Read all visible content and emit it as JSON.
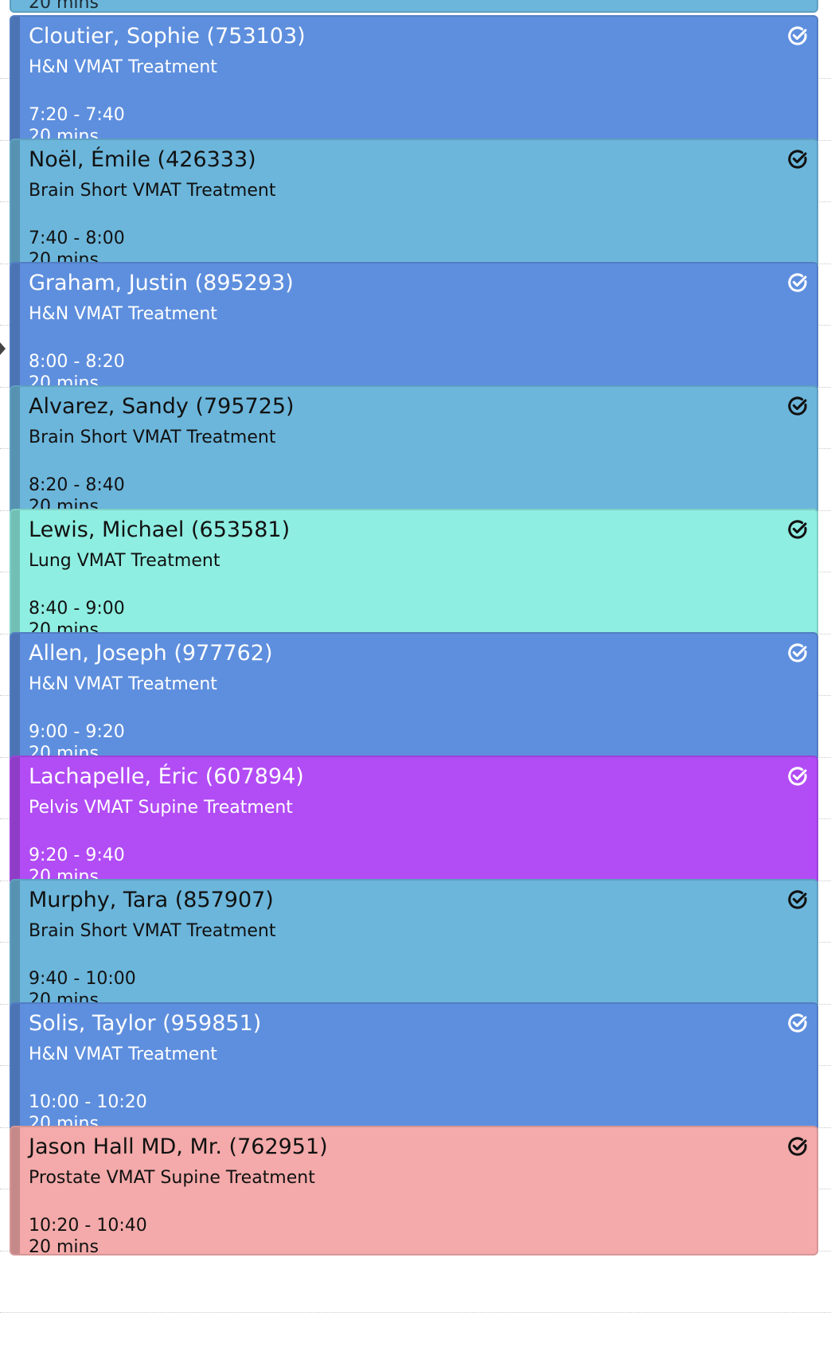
{
  "calendar": {
    "top_partial": {
      "duration": "20 mins",
      "color": "#6cb6db",
      "text_color": "#1d2a33"
    },
    "appointments": [
      {
        "patient": "Cloutier, Sophie (753103)",
        "procedure": "H&N VMAT Treatment",
        "time": "7:20 - 7:40",
        "duration": "20 mins",
        "color": "#5e8fde",
        "text_color": "#ffffff",
        "status_icon": "check-circle-icon"
      },
      {
        "patient": "Noël, Émile (426333)",
        "procedure": "Brain Short VMAT Treatment",
        "time": "7:40 - 8:00",
        "duration": "20 mins",
        "color": "#6cb6db",
        "text_color": "#111111",
        "status_icon": "check-circle-icon"
      },
      {
        "patient": "Graham, Justin (895293)",
        "procedure": "H&N VMAT Treatment",
        "time": "8:00 - 8:20",
        "duration": "20 mins",
        "color": "#5e8fde",
        "text_color": "#ffffff",
        "status_icon": "check-circle-icon"
      },
      {
        "patient": "Alvarez, Sandy (795725)",
        "procedure": "Brain Short VMAT Treatment",
        "time": "8:20 - 8:40",
        "duration": "20 mins",
        "color": "#6cb6db",
        "text_color": "#111111",
        "status_icon": "check-circle-icon"
      },
      {
        "patient": "Lewis, Michael (653581)",
        "procedure": "Lung VMAT Treatment",
        "time": "8:40 - 9:00",
        "duration": "20 mins",
        "color": "#8eeee1",
        "text_color": "#111111",
        "status_icon": "check-circle-icon"
      },
      {
        "patient": "Allen, Joseph (977762)",
        "procedure": "H&N VMAT Treatment",
        "time": "9:00 - 9:20",
        "duration": "20 mins",
        "color": "#5e8fde",
        "text_color": "#ffffff",
        "status_icon": "check-circle-icon"
      },
      {
        "patient": "Lachapelle, Éric (607894)",
        "procedure": "Pelvis VMAT Supine Treatment",
        "time": "9:20 - 9:40",
        "duration": "20 mins",
        "color": "#b24cf5",
        "text_color": "#ffffff",
        "status_icon": "check-circle-icon"
      },
      {
        "patient": "Murphy, Tara (857907)",
        "procedure": "Brain Short VMAT Treatment",
        "time": "9:40 - 10:00",
        "duration": "20 mins",
        "color": "#6cb6db",
        "text_color": "#111111",
        "status_icon": "check-circle-icon"
      },
      {
        "patient": "Solis, Taylor (959851)",
        "procedure": "H&N VMAT Treatment",
        "time": "10:00 - 10:20",
        "duration": "20 mins",
        "color": "#5e8fde",
        "text_color": "#ffffff",
        "status_icon": "check-circle-icon"
      },
      {
        "patient": "Jason Hall MD, Mr. (762951)",
        "procedure": "Prostate VMAT Supine Treatment",
        "time": "10:20 - 10:40",
        "duration": "20 mins",
        "color": "#f4aaaa",
        "text_color": "#111111",
        "status_icon": "check-circle-icon"
      }
    ]
  }
}
